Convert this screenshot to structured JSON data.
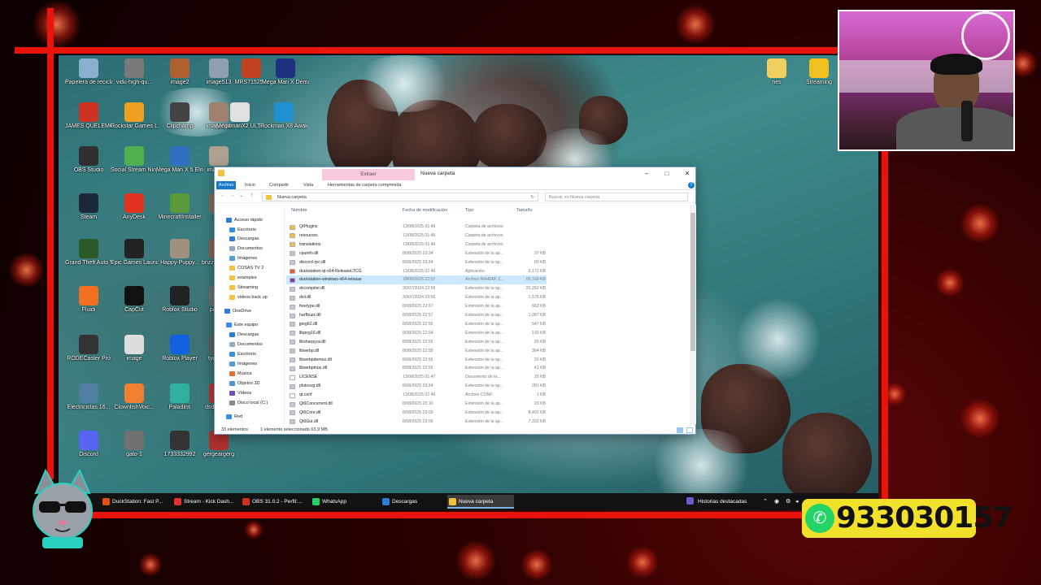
{
  "desktop_icons": [
    {
      "label": "Papelera de reciclaje",
      "color": "#8ab0d0"
    },
    {
      "label": "vidu-high-qu...",
      "color": "#7a7a7a"
    },
    {
      "label": "image2",
      "color": "#b06030"
    },
    {
      "label": "image513",
      "color": "#90a0b0"
    },
    {
      "label": "MRS71525...",
      "color": "#c04020"
    },
    {
      "label": "Mega Man X Demake (Mo...",
      "color": "#203080"
    },
    {
      "label": "JAMES QUELEMO",
      "color": "#cc3322"
    },
    {
      "label": "Rockstar Games Launcher",
      "color": "#f0a020"
    },
    {
      "label": "Clipchamp",
      "color": "#444"
    },
    {
      "label": "image600",
      "color": "#a08070"
    },
    {
      "label": "MegamanX2 ULTIMATE",
      "color": "#e0e0e0"
    },
    {
      "label": "Rockman X8 Awakening...",
      "color": "#2090d0"
    },
    {
      "label": "OBS Studio",
      "color": "#303030"
    },
    {
      "label": "Social Stream Ninja",
      "color": "#50b050"
    },
    {
      "label": "Mega Man X 5 Elite...",
      "color": "#3070c0"
    },
    {
      "label": "imagepdf",
      "color": "#b0a090"
    },
    {
      "label": "Steam",
      "color": "#1b2838"
    },
    {
      "label": "AnyDesk",
      "color": "#e03020"
    },
    {
      "label": "MinecraftInstaller",
      "color": "#5a9a3a"
    },
    {
      "label": "fgfgf",
      "color": "#8a6a5a"
    },
    {
      "label": "Grand Theft Auto V Legacy",
      "color": "#2a5a2a"
    },
    {
      "label": "Epic Games Launcher",
      "color": "#222"
    },
    {
      "label": "Happy-Puppy...",
      "color": "#a09080"
    },
    {
      "label": "brizzersfghf...",
      "color": "#906050"
    },
    {
      "label": "Fluidi",
      "color": "#f07020"
    },
    {
      "label": "CapCut",
      "color": "#111"
    },
    {
      "label": "Roblox Studio",
      "color": "#222"
    },
    {
      "label": "pasaflu",
      "color": "#707070"
    },
    {
      "label": "RODECaster Pro",
      "color": "#333"
    },
    {
      "label": "image",
      "color": "#ddd"
    },
    {
      "label": "Roblox Player",
      "color": "#1060e0"
    },
    {
      "label": "tyukryuk",
      "color": "#606060"
    },
    {
      "label": "Electricistas 16...",
      "color": "#5080a0"
    },
    {
      "label": "ClownfishVoic...",
      "color": "#f08030"
    },
    {
      "label": "Paladins",
      "color": "#30b0a0"
    },
    {
      "label": "dsdasdasd",
      "color": "#c03030"
    },
    {
      "label": "Discord",
      "color": "#5865f2"
    },
    {
      "label": "gato-1",
      "color": "#707070"
    },
    {
      "label": "1733332992",
      "color": "#333"
    },
    {
      "label": "gergeargerg",
      "color": "#b03030"
    },
    {
      "label": "nes",
      "color": "#f0d060"
    },
    {
      "label": "Streaming",
      "color": "#f0c020"
    }
  ],
  "explorer": {
    "title": "Nueva carpeta",
    "contextual_tab": "Extraer",
    "ribbon_tabs": [
      "Archivo",
      "Inicio",
      "Compartir",
      "Vista",
      "Herramientas de carpeta comprimida"
    ],
    "address": "Nueva carpeta",
    "search_placeholder": "Buscar en Nueva carpeta",
    "columns": {
      "name": "Nombre",
      "date": "Fecha de modificación",
      "type": "Tipo",
      "size": "Tamaño"
    },
    "nav": [
      {
        "label": "Acceso rápido",
        "color": "#2f7bd8"
      },
      {
        "label": "Escritorio",
        "color": "#3a8ee0"
      },
      {
        "label": "Descargas",
        "color": "#2f7bd8"
      },
      {
        "label": "Documentos",
        "color": "#90a8c0"
      },
      {
        "label": "Imágenes",
        "color": "#50a0d0"
      },
      {
        "label": "COSAS TV 2",
        "color": "#f0c040"
      },
      {
        "label": "examples",
        "color": "#f0c040"
      },
      {
        "label": "Streaming",
        "color": "#f0c040"
      },
      {
        "label": "videos back up",
        "color": "#f0c040"
      },
      {
        "label": "OneDrive",
        "color": "#2f7bd8"
      },
      {
        "label": "Este equipo",
        "color": "#3a8ee0"
      },
      {
        "label": "Descargas",
        "color": "#2f7bd8"
      },
      {
        "label": "Documentos",
        "color": "#90a8c0"
      },
      {
        "label": "Escritorio",
        "color": "#3a8ee0"
      },
      {
        "label": "Imágenes",
        "color": "#50a0d0"
      },
      {
        "label": "Música",
        "color": "#e07030"
      },
      {
        "label": "Objetos 3D",
        "color": "#5090d0"
      },
      {
        "label": "Vídeos",
        "color": "#7050c0"
      },
      {
        "label": "Disco local (C:)",
        "color": "#888"
      },
      {
        "label": "Red",
        "color": "#3a8ee0"
      }
    ],
    "files": [
      {
        "name": "QtPlugins",
        "date": "13/08/2025 01:46",
        "type": "Carpeta de archivos",
        "size": "",
        "icon": "#f0c040"
      },
      {
        "name": "resources",
        "date": "13/08/2025 01:46",
        "type": "Carpeta de archivos",
        "size": "",
        "icon": "#f0c040"
      },
      {
        "name": "translations",
        "date": "13/08/2025 01:46",
        "type": "Carpeta de archivos",
        "size": "",
        "icon": "#f0c040"
      },
      {
        "name": "cpuinfo.dll",
        "date": "8/08/2025 23:34",
        "type": "Extensión de la ap...",
        "size": "37 KB",
        "icon": "#c0c8d0"
      },
      {
        "name": "discord-rpc.dll",
        "date": "8/08/2025 23:34",
        "type": "Extensión de la ap...",
        "size": "60 KB",
        "icon": "#c0c8d0"
      },
      {
        "name": "duckstation-qt-x64-ReleaseLTCG",
        "date": "13/08/2025 01:46",
        "type": "Aplicación",
        "size": "9,172 KB",
        "icon": "#e06030"
      },
      {
        "name": "duckstation-windows-x64-release",
        "date": "18/08/2025 22:07",
        "type": "Archivo WinRAR Z...",
        "size": "65,318 KB",
        "icon": "#8040a0"
      },
      {
        "name": "dxcompiler.dll",
        "date": "30/07/2024 23:56",
        "type": "Extensión de la ap...",
        "size": "20,262 KB",
        "icon": "#c0c8d0"
      },
      {
        "name": "dxil.dll",
        "date": "30/07/2024 23:56",
        "type": "Extensión de la ap...",
        "size": "1,575 KB",
        "icon": "#c0c8d0"
      },
      {
        "name": "freetype.dll",
        "date": "8/08/2025 22:57",
        "type": "Extensión de la ap...",
        "size": "663 KB",
        "icon": "#c0c8d0"
      },
      {
        "name": "harfbuzz.dll",
        "date": "8/08/2025 22:57",
        "type": "Extensión de la ap...",
        "size": "1,087 KB",
        "icon": "#c0c8d0"
      },
      {
        "name": "jpeg62.dll",
        "date": "8/08/2025 22:55",
        "type": "Extensión de la ap...",
        "size": "547 KB",
        "icon": "#c0c8d0"
      },
      {
        "name": "libpng16.dll",
        "date": "8/08/2025 22:54",
        "type": "Extensión de la ap...",
        "size": "192 KB",
        "icon": "#c0c8d0"
      },
      {
        "name": "libsharpyuv.dll",
        "date": "8/08/2025 22:55",
        "type": "Extensión de la ap...",
        "size": "25 KB",
        "icon": "#c0c8d0"
      },
      {
        "name": "libwebp.dll",
        "date": "8/08/2025 22:55",
        "type": "Extensión de la ap...",
        "size": "364 KB",
        "icon": "#c0c8d0"
      },
      {
        "name": "libwebpdemux.dll",
        "date": "8/08/2025 22:55",
        "type": "Extensión de la ap...",
        "size": "20 KB",
        "icon": "#c0c8d0"
      },
      {
        "name": "libwebpmux.dll",
        "date": "8/08/2025 22:55",
        "type": "Extensión de la ap...",
        "size": "41 KB",
        "icon": "#c0c8d0"
      },
      {
        "name": "LICENSE",
        "date": "13/08/2025 01:47",
        "type": "Documento de te...",
        "size": "20 KB",
        "icon": "#ffffff"
      },
      {
        "name": "plutosvg.dll",
        "date": "8/08/2025 23:34",
        "type": "Extensión de la ap...",
        "size": "281 KB",
        "icon": "#c0c8d0"
      },
      {
        "name": "qt.conf",
        "date": "13/08/2025 01:46",
        "type": "Archivo CONF",
        "size": "1 KB",
        "icon": "#ffffff"
      },
      {
        "name": "Qt6Concurrent.dll",
        "date": "8/08/2025 23:10",
        "type": "Extensión de la ap...",
        "size": "23 KB",
        "icon": "#c0c8d0"
      },
      {
        "name": "Qt6Core.dll",
        "date": "8/08/2025 23:09",
        "type": "Extensión de la ap...",
        "size": "8,402 KB",
        "icon": "#c0c8d0"
      },
      {
        "name": "Qt6Gui.dll",
        "date": "8/08/2025 23:09",
        "type": "Extensión de la ap...",
        "size": "7,332 KB",
        "icon": "#c0c8d0"
      }
    ],
    "selected_index": 6,
    "status_count": "33 elementos",
    "status_selected": "1 elemento seleccionado  63,9 MB"
  },
  "taskbar": {
    "items": [
      {
        "label": "DuckStation: Fast P...",
        "color": "#e05010"
      },
      {
        "label": "Stream - Kick Dash...",
        "color": "#e03030"
      },
      {
        "label": "OBS 31.0.2 - Perfil:...",
        "color": "#d03020"
      },
      {
        "label": "WhatsApp",
        "color": "#25d366"
      },
      {
        "label": "Descargas",
        "color": "#2f7bd8"
      },
      {
        "label": "Nueva carpeta",
        "color": "#f0c040"
      }
    ],
    "active_index": 5,
    "news_label": "Historias destacadas"
  },
  "overlay": {
    "phone": "933030157"
  }
}
